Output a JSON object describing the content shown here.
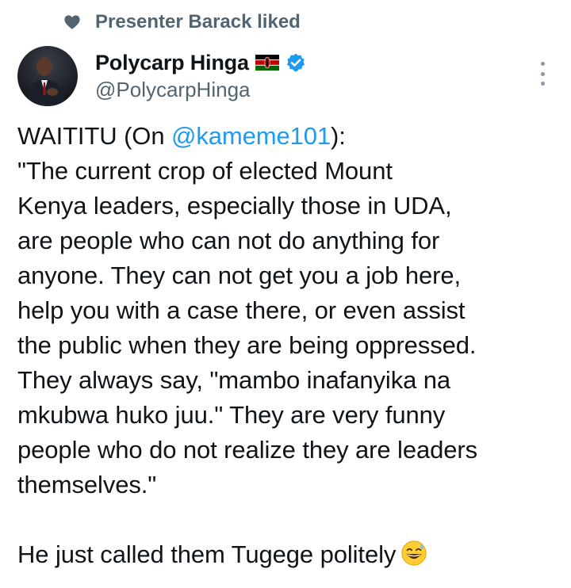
{
  "social_context": {
    "icon": "heart-icon",
    "text": "Presenter Barack liked"
  },
  "author": {
    "display_name": "Polycarp Hinga",
    "flag_icon": "kenya-flag-icon",
    "verified_icon": "verified-badge-icon",
    "handle": "@PolycarpHinga"
  },
  "more_icon": "more-options-icon",
  "tweet": {
    "line1_prefix": "WAITITU (On ",
    "line1_mention": "@kameme101",
    "line1_suffix": "):",
    "lines": [
      "\"The current crop of elected Mount",
      "Kenya leaders, especially those in UDA,",
      "are people who can not do anything for",
      "anyone. They can not get you a job here,",
      "help you with a case there, or even assist",
      "the public when they are being oppressed.",
      "They always say, \"mambo inafanyika na",
      "mkubwa huko juu.\" They are very funny",
      "people who do not realize they are leaders",
      "themselves.\""
    ],
    "closing": "He just called them Tugege politely",
    "closing_emoji": "grinning-sweat-emoji"
  },
  "colors": {
    "text": "#0f1419",
    "secondary": "#536471",
    "link": "#1d9bf0",
    "verified": "#1d9bf0"
  }
}
